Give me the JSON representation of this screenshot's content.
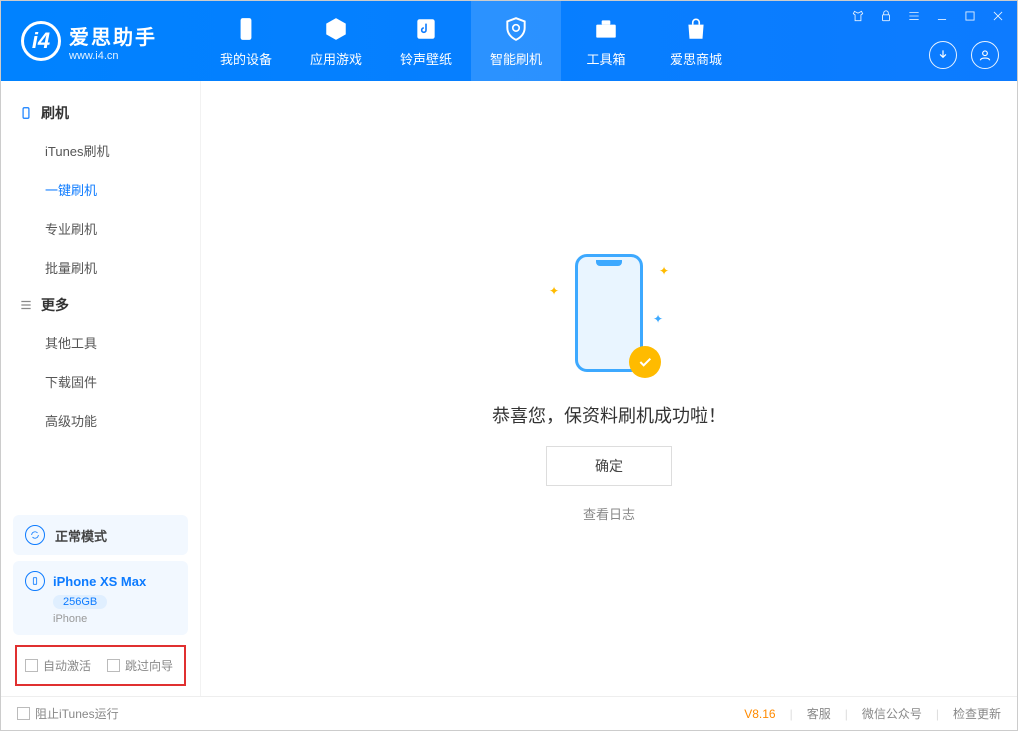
{
  "app": {
    "title": "爱思助手",
    "subtitle": "www.i4.cn"
  },
  "nav": {
    "tabs": [
      {
        "label": "我的设备"
      },
      {
        "label": "应用游戏"
      },
      {
        "label": "铃声壁纸"
      },
      {
        "label": "智能刷机"
      },
      {
        "label": "工具箱"
      },
      {
        "label": "爱思商城"
      }
    ]
  },
  "sidebar": {
    "section_flash": "刷机",
    "items_flash": [
      {
        "label": "iTunes刷机"
      },
      {
        "label": "一键刷机"
      },
      {
        "label": "专业刷机"
      },
      {
        "label": "批量刷机"
      }
    ],
    "section_more": "更多",
    "items_more": [
      {
        "label": "其他工具"
      },
      {
        "label": "下载固件"
      },
      {
        "label": "高级功能"
      }
    ],
    "mode_label": "正常模式",
    "device": {
      "name": "iPhone XS Max",
      "capacity": "256GB",
      "type": "iPhone"
    },
    "check_auto_activate": "自动激活",
    "check_skip_guide": "跳过向导"
  },
  "main": {
    "success_message": "恭喜您，保资料刷机成功啦！",
    "confirm_label": "确定",
    "view_log_label": "查看日志"
  },
  "footer": {
    "block_itunes_label": "阻止iTunes运行",
    "version": "V8.16",
    "link_support": "客服",
    "link_wechat": "微信公众号",
    "link_update": "检查更新"
  }
}
